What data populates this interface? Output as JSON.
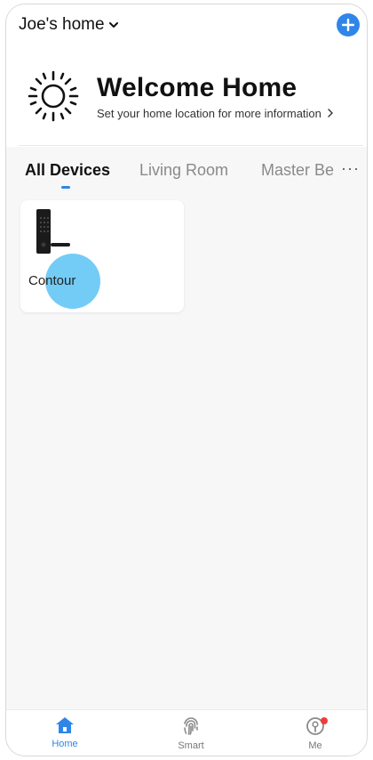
{
  "header": {
    "home_name": "Joe's home"
  },
  "welcome": {
    "title": "Welcome Home",
    "subtitle": "Set your home location for more information"
  },
  "tabs": [
    {
      "label": "All Devices",
      "active": true
    },
    {
      "label": "Living Room",
      "active": false
    },
    {
      "label": "Master Be",
      "active": false
    }
  ],
  "more_label": "···",
  "devices": [
    {
      "name": "Contour",
      "icon": "door-lock-icon"
    }
  ],
  "bottom_nav": [
    {
      "label": "Home",
      "icon": "home-icon",
      "active": true
    },
    {
      "label": "Smart",
      "icon": "fingerprint-icon",
      "active": false
    },
    {
      "label": "Me",
      "icon": "profile-icon",
      "active": false,
      "notification": true
    }
  ],
  "colors": {
    "accent": "#2f86e8",
    "background": "#f7f7f7",
    "notification": "#f03b3b",
    "touch": "#5ac3f5"
  }
}
